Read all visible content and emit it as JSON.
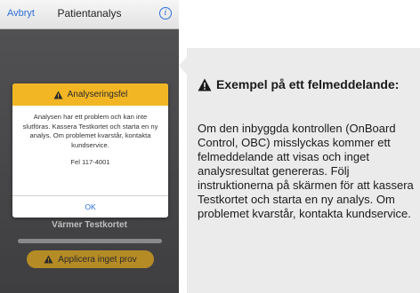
{
  "phone": {
    "nav": {
      "back_label": "Avbryt",
      "title": "Patientanalys",
      "info_glyph": "i",
      "info_icon": "info-icon"
    },
    "dialog": {
      "title": "Analyseringsfel",
      "message": "Analysen har ett problem och kan inte slutföras. Kassera Testkortet och starta en ny analys. Om problemet kvarstår, kontakta kundservice.",
      "code": "Fel 117-4001",
      "ok_label": "OK",
      "header_color": "#f2b624",
      "icon": "warning-icon"
    },
    "status_text": "Värmer Testkortet",
    "progress": 0,
    "prompt_label": "Applicera inget prov",
    "prompt_color": "#b58b26",
    "prompt_icon": "warning-icon"
  },
  "callout": {
    "icon": "warning-icon",
    "title": "Exempel på ett felmeddelande:",
    "text": "Om den inbyggda kontrollen (OnBoard Control, OBC) misslyckas kommer ett felmeddelande att visas och inget analysresultat genereras. Följ instruktionerna på skärmen för att kassera Testkortet och starta en ny analys. Om problemet kvarstår, kontakta kundservice."
  }
}
